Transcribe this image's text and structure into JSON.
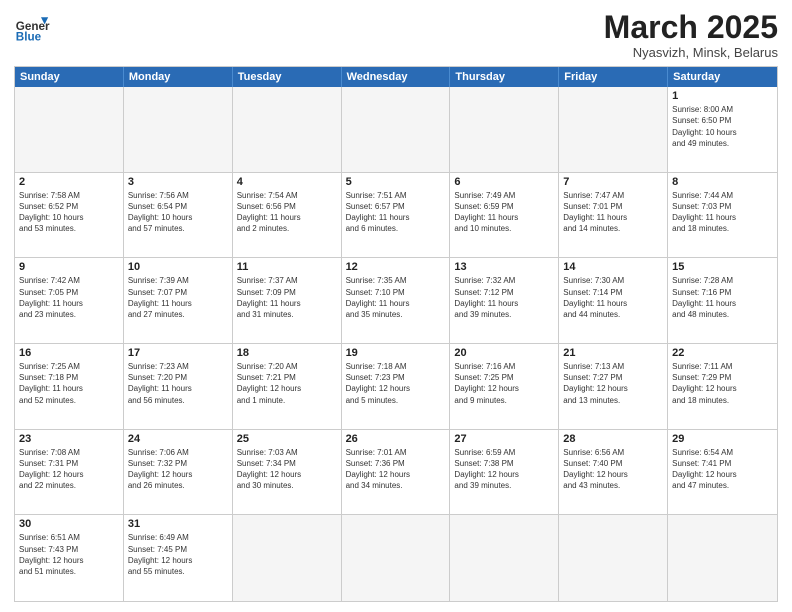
{
  "header": {
    "logo_general": "General",
    "logo_blue": "Blue",
    "month_title": "March 2025",
    "subtitle": "Nyasvizh, Minsk, Belarus"
  },
  "weekdays": [
    "Sunday",
    "Monday",
    "Tuesday",
    "Wednesday",
    "Thursday",
    "Friday",
    "Saturday"
  ],
  "cells": [
    {
      "day": "",
      "text": "",
      "empty": true
    },
    {
      "day": "",
      "text": "",
      "empty": true
    },
    {
      "day": "",
      "text": "",
      "empty": true
    },
    {
      "day": "",
      "text": "",
      "empty": true
    },
    {
      "day": "",
      "text": "",
      "empty": true
    },
    {
      "day": "",
      "text": "",
      "empty": true
    },
    {
      "day": "1",
      "text": "Sunrise: 8:00 AM\nSunset: 6:50 PM\nDaylight: 10 hours\nand 49 minutes."
    },
    {
      "day": "2",
      "text": "Sunrise: 7:58 AM\nSunset: 6:52 PM\nDaylight: 10 hours\nand 53 minutes."
    },
    {
      "day": "3",
      "text": "Sunrise: 7:56 AM\nSunset: 6:54 PM\nDaylight: 10 hours\nand 57 minutes."
    },
    {
      "day": "4",
      "text": "Sunrise: 7:54 AM\nSunset: 6:56 PM\nDaylight: 11 hours\nand 2 minutes."
    },
    {
      "day": "5",
      "text": "Sunrise: 7:51 AM\nSunset: 6:57 PM\nDaylight: 11 hours\nand 6 minutes."
    },
    {
      "day": "6",
      "text": "Sunrise: 7:49 AM\nSunset: 6:59 PM\nDaylight: 11 hours\nand 10 minutes."
    },
    {
      "day": "7",
      "text": "Sunrise: 7:47 AM\nSunset: 7:01 PM\nDaylight: 11 hours\nand 14 minutes."
    },
    {
      "day": "8",
      "text": "Sunrise: 7:44 AM\nSunset: 7:03 PM\nDaylight: 11 hours\nand 18 minutes."
    },
    {
      "day": "9",
      "text": "Sunrise: 7:42 AM\nSunset: 7:05 PM\nDaylight: 11 hours\nand 23 minutes."
    },
    {
      "day": "10",
      "text": "Sunrise: 7:39 AM\nSunset: 7:07 PM\nDaylight: 11 hours\nand 27 minutes."
    },
    {
      "day": "11",
      "text": "Sunrise: 7:37 AM\nSunset: 7:09 PM\nDaylight: 11 hours\nand 31 minutes."
    },
    {
      "day": "12",
      "text": "Sunrise: 7:35 AM\nSunset: 7:10 PM\nDaylight: 11 hours\nand 35 minutes."
    },
    {
      "day": "13",
      "text": "Sunrise: 7:32 AM\nSunset: 7:12 PM\nDaylight: 11 hours\nand 39 minutes."
    },
    {
      "day": "14",
      "text": "Sunrise: 7:30 AM\nSunset: 7:14 PM\nDaylight: 11 hours\nand 44 minutes."
    },
    {
      "day": "15",
      "text": "Sunrise: 7:28 AM\nSunset: 7:16 PM\nDaylight: 11 hours\nand 48 minutes."
    },
    {
      "day": "16",
      "text": "Sunrise: 7:25 AM\nSunset: 7:18 PM\nDaylight: 11 hours\nand 52 minutes."
    },
    {
      "day": "17",
      "text": "Sunrise: 7:23 AM\nSunset: 7:20 PM\nDaylight: 11 hours\nand 56 minutes."
    },
    {
      "day": "18",
      "text": "Sunrise: 7:20 AM\nSunset: 7:21 PM\nDaylight: 12 hours\nand 1 minute."
    },
    {
      "day": "19",
      "text": "Sunrise: 7:18 AM\nSunset: 7:23 PM\nDaylight: 12 hours\nand 5 minutes."
    },
    {
      "day": "20",
      "text": "Sunrise: 7:16 AM\nSunset: 7:25 PM\nDaylight: 12 hours\nand 9 minutes."
    },
    {
      "day": "21",
      "text": "Sunrise: 7:13 AM\nSunset: 7:27 PM\nDaylight: 12 hours\nand 13 minutes."
    },
    {
      "day": "22",
      "text": "Sunrise: 7:11 AM\nSunset: 7:29 PM\nDaylight: 12 hours\nand 18 minutes."
    },
    {
      "day": "23",
      "text": "Sunrise: 7:08 AM\nSunset: 7:31 PM\nDaylight: 12 hours\nand 22 minutes."
    },
    {
      "day": "24",
      "text": "Sunrise: 7:06 AM\nSunset: 7:32 PM\nDaylight: 12 hours\nand 26 minutes."
    },
    {
      "day": "25",
      "text": "Sunrise: 7:03 AM\nSunset: 7:34 PM\nDaylight: 12 hours\nand 30 minutes."
    },
    {
      "day": "26",
      "text": "Sunrise: 7:01 AM\nSunset: 7:36 PM\nDaylight: 12 hours\nand 34 minutes."
    },
    {
      "day": "27",
      "text": "Sunrise: 6:59 AM\nSunset: 7:38 PM\nDaylight: 12 hours\nand 39 minutes."
    },
    {
      "day": "28",
      "text": "Sunrise: 6:56 AM\nSunset: 7:40 PM\nDaylight: 12 hours\nand 43 minutes."
    },
    {
      "day": "29",
      "text": "Sunrise: 6:54 AM\nSunset: 7:41 PM\nDaylight: 12 hours\nand 47 minutes."
    },
    {
      "day": "30",
      "text": "Sunrise: 6:51 AM\nSunset: 7:43 PM\nDaylight: 12 hours\nand 51 minutes."
    },
    {
      "day": "31",
      "text": "Sunrise: 6:49 AM\nSunset: 7:45 PM\nDaylight: 12 hours\nand 55 minutes."
    },
    {
      "day": "",
      "text": "",
      "empty": true
    },
    {
      "day": "",
      "text": "",
      "empty": true
    },
    {
      "day": "",
      "text": "",
      "empty": true
    },
    {
      "day": "",
      "text": "",
      "empty": true
    },
    {
      "day": "",
      "text": "",
      "empty": true
    }
  ]
}
